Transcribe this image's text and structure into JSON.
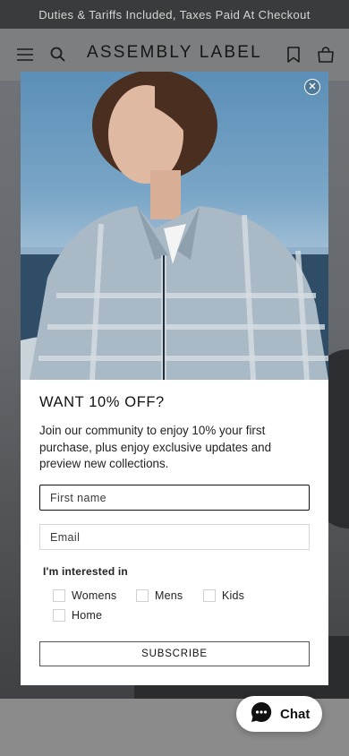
{
  "announcement": {
    "text": "Duties & Tariffs Included, Taxes Paid At Checkout"
  },
  "header": {
    "logo": "ASSEMBLY LABEL",
    "icons": [
      "menu-icon",
      "search-icon",
      "bookmark-icon",
      "bag-icon"
    ]
  },
  "popup": {
    "title": "WANT 10% OFF?",
    "description": "Join our community to enjoy 10% your first purchase, plus enjoy exclusive updates and preview new collections.",
    "first_name_placeholder": "First name",
    "email_placeholder": "Email",
    "interest_label": "I'm interested in",
    "options": [
      {
        "label": "Womens",
        "checked": false
      },
      {
        "label": "Mens",
        "checked": false
      },
      {
        "label": "Kids",
        "checked": false
      },
      {
        "label": "Home",
        "checked": false
      }
    ],
    "subscribe_label": "SUBSCRIBE"
  },
  "chat": {
    "label": "Chat"
  },
  "colors": {
    "announcement_bg": "#3a3b3c",
    "overlay": "#7d7e80",
    "modal_bg": "#ffffff",
    "text": "#111111"
  }
}
